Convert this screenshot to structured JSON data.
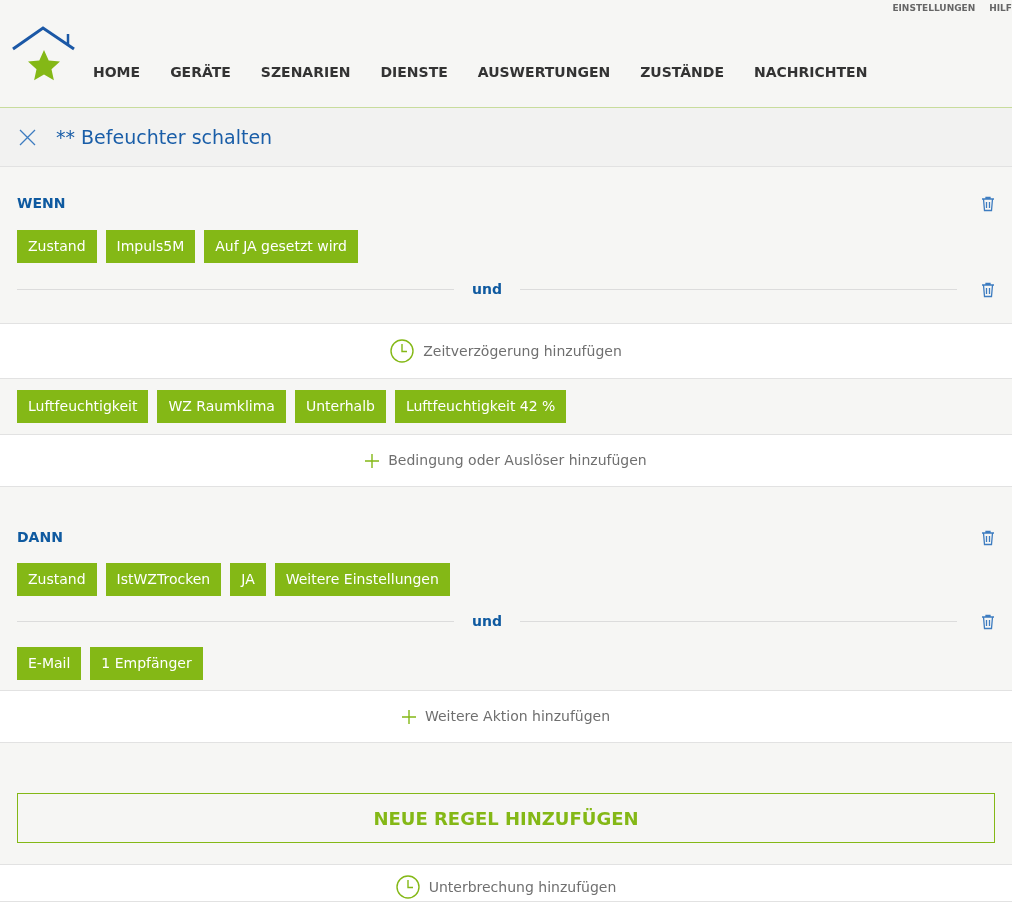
{
  "top_links": [
    "EINSTELLUNGEN",
    "HILF"
  ],
  "nav": [
    {
      "label": "HOME",
      "selected": false
    },
    {
      "label": "GERÄTE",
      "selected": false
    },
    {
      "label": "SZENARIEN",
      "selected": false
    },
    {
      "label": "DIENSTE",
      "selected": false
    },
    {
      "label": "AUSWERTUNGEN",
      "selected": false
    },
    {
      "label": "ZUSTÄNDE",
      "selected": false
    },
    {
      "label": "NACHRICHTEN",
      "selected": false
    }
  ],
  "title": "** Befeuchter schalten",
  "sections": [
    {
      "kind": "panel",
      "blocks": [
        {
          "kind": "heading",
          "text": "WENN"
        },
        {
          "kind": "chips",
          "chips": [
            "Zustand",
            "Impuls5M",
            "Auf JA gesetzt wird"
          ]
        },
        {
          "kind": "connector",
          "text": "und"
        }
      ]
    },
    {
      "kind": "delay",
      "text": "Zeitverzögerung hinzufügen"
    },
    {
      "kind": "panel",
      "blocks": [
        {
          "kind": "chips",
          "chips": [
            "Luftfeuchtigkeit",
            "WZ Raumklima",
            "Unterhalb",
            "Luftfeuchtigkeit 42 %"
          ]
        }
      ]
    },
    {
      "kind": "add",
      "text": "Bedingung oder Auslöser hinzufügen"
    },
    {
      "kind": "panel",
      "blocks": [
        {
          "kind": "heading",
          "text": "DANN"
        },
        {
          "kind": "chips",
          "chips": [
            "Zustand",
            "IstWZTrocken",
            "JA",
            "Weitere Einstellungen"
          ]
        },
        {
          "kind": "connector",
          "text": "und"
        },
        {
          "kind": "chips",
          "chips": [
            "E-Mail",
            "1 Empfänger"
          ]
        }
      ]
    },
    {
      "kind": "add",
      "text": "Weitere Aktion hinzufügen"
    },
    {
      "kind": "button",
      "text": "NEUE REGEL HINZUFÜGEN"
    },
    {
      "kind": "delay",
      "text": "Unterbrechung hinzufügen"
    }
  ]
}
